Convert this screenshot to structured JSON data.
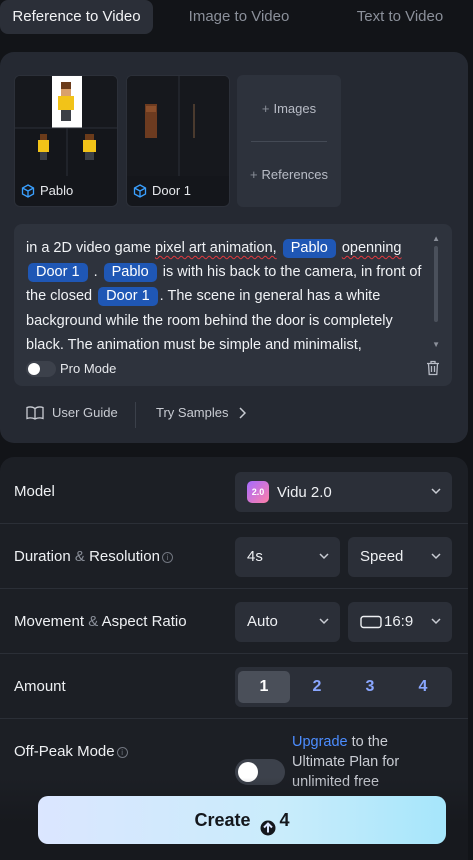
{
  "tabs": [
    {
      "label": "Reference to Video"
    },
    {
      "label": "Image to Video"
    },
    {
      "label": "Text to Video"
    }
  ],
  "references": [
    {
      "name": "Pablo",
      "icon": "cube-icon"
    },
    {
      "name": "Door 1",
      "icon": "cube-icon"
    }
  ],
  "add_tile": {
    "images": "Images",
    "references": "References"
  },
  "prompt": {
    "p1": "in a 2D video game ",
    "p2": "pixel art animation,",
    "tag1": "Pablo",
    "p3": "openning",
    "tag2": "Door 1",
    "p4": ".",
    "tag3": "Pablo",
    "p5": " is with his back to the camera, in front of the closed ",
    "tag4": "Door 1",
    "p6": ". The scene in general has a white background while the room behind the door is completely black. The animation must be simple and minimalist,"
  },
  "pro_mode": {
    "label": "Pro Mode",
    "enabled": false
  },
  "links": {
    "guide": "User Guide",
    "samples": "Try Samples"
  },
  "settings": {
    "model": {
      "label": "Model",
      "value": "Vidu 2.0",
      "logo_text": "2.0"
    },
    "duration": {
      "label1": "Duration",
      "amp": "&",
      "label2": "Resolution",
      "value": "4s",
      "resolution": "Speed"
    },
    "movement": {
      "label1": "Movement",
      "amp": "&",
      "label2": "Aspect Ratio",
      "value": "Auto",
      "ratio": "16:9"
    },
    "amount": {
      "label": "Amount",
      "options": [
        "1",
        "2",
        "3",
        "4"
      ],
      "selected": "1"
    },
    "offpeak": {
      "label": "Off-Peak Mode",
      "enabled": false,
      "upgrade_link": "Upgrade",
      "upgrade_text": " to the Ultimate Plan for unlimited free"
    }
  },
  "create": {
    "label": "Create",
    "cost": "4"
  },
  "colors": {
    "accent": "#1f57b5",
    "link": "#4c8dff",
    "create_start": "#dbe6ff",
    "create_end": "#a6e6fb"
  }
}
